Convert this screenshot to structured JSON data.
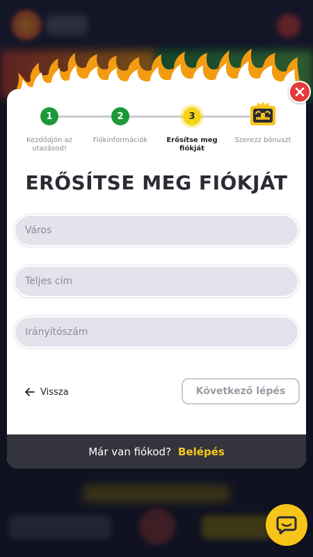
{
  "stepper": {
    "steps": [
      {
        "number": "1",
        "label": "Kezdődjön az utazásod!",
        "state": "done"
      },
      {
        "number": "2",
        "label": "Fiókinformációk",
        "state": "done"
      },
      {
        "number": "3",
        "label": "Erősítse meg fiókját",
        "state": "active"
      },
      {
        "number": "",
        "label": "Szerezz bónuszt",
        "state": "pending",
        "icon": "treasure-chest-icon"
      }
    ]
  },
  "modal": {
    "title": "ERŐSÍTSE MEG FIÓKJÁT",
    "fields": {
      "city_placeholder": "Város",
      "address_placeholder": "Teljes cím",
      "zip_placeholder": "Irányítószám"
    },
    "back_label": "Vissza",
    "next_label": "Következő lépés",
    "footer": {
      "question": "Már van fiókod?",
      "login_label": "Belépés"
    }
  },
  "colors": {
    "step_done": "#1c9a3a",
    "step_active": "#f7d31a",
    "accent_yellow": "#f7c51a",
    "close_red": "#e23b3b",
    "footer_bg": "#33343d"
  },
  "icons": [
    "close-icon",
    "treasure-chest-icon",
    "arrow-left-icon",
    "chat-icon"
  ]
}
